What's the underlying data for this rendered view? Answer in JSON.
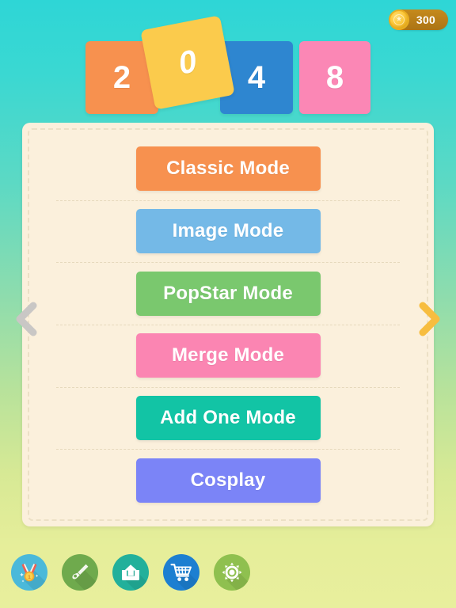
{
  "app": {
    "title": "2048 Game Mode Selection",
    "background_top_color": "#2ed6d6",
    "background_bottom_color": "#e8ef9d"
  },
  "header": {
    "coin": {
      "icon": "coin-icon",
      "star_glyph": "★",
      "amount": "300",
      "badge_color": "#b57a17",
      "coin_color": "#fdc93c"
    },
    "logo_tiles": [
      {
        "value": "2",
        "color": "#f7914f",
        "name": "logo-tile-2"
      },
      {
        "value": "0",
        "color": "#fbcb4c",
        "name": "logo-tile-0"
      },
      {
        "value": "4",
        "color": "#2e86d0",
        "name": "logo-tile-4"
      },
      {
        "value": "8",
        "color": "#fb87b5",
        "name": "logo-tile-8"
      }
    ]
  },
  "menu": {
    "panel_color": "#fbf0dc",
    "items": [
      {
        "label": "Classic Mode",
        "color": "#f7914f"
      },
      {
        "label": "Image Mode",
        "color": "#74b9e7"
      },
      {
        "label": "PopStar Mode",
        "color": "#7ac86e"
      },
      {
        "label": "Merge Mode",
        "color": "#fb85b2"
      },
      {
        "label": "Add One Mode",
        "color": "#12c4a5"
      },
      {
        "label": "Cosplay",
        "color": "#7b84f7"
      }
    ]
  },
  "navigation": {
    "prev": {
      "icon": "chevron-left-icon",
      "color": "#c9c7c5",
      "label": "Previous page"
    },
    "next": {
      "icon": "chevron-right-icon",
      "color": "#f7bd3f",
      "label": "Next page"
    }
  },
  "toolbar": {
    "items": [
      {
        "icon": "medal-icon",
        "label": "Achievements",
        "circle_color": "#4ab9da"
      },
      {
        "icon": "brush-icon",
        "label": "Theme",
        "circle_color": "#6faa4d"
      },
      {
        "icon": "share-icon",
        "label": "Share",
        "circle_color": "#22b09b"
      },
      {
        "icon": "cart-icon",
        "label": "Shop",
        "circle_color": "#1d7fd1"
      },
      {
        "icon": "gear-icon",
        "label": "Settings",
        "circle_color": "#8fc04f"
      }
    ]
  }
}
